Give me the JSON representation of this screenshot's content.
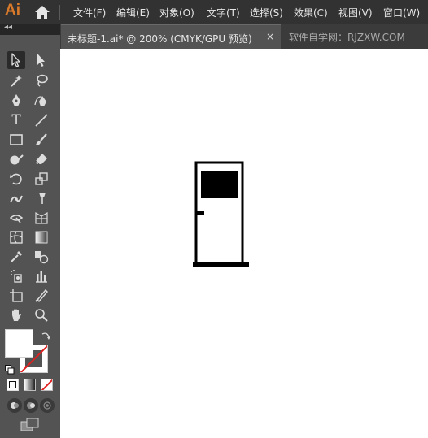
{
  "app": {
    "logo": "Ai"
  },
  "menu": {
    "items": [
      "文件(F)",
      "编辑(E)",
      "对象(O)",
      "文字(T)",
      "选择(S)",
      "效果(C)",
      "视图(V)",
      "窗口(W)"
    ]
  },
  "tabs": {
    "active_label": "未标题-1.ai* @ 200% (CMYK/GPU 预览)",
    "close": "×",
    "other_label": "软件自学网：RJZXW.COM"
  },
  "panel": {
    "collapse": "◂◂"
  },
  "tools": {
    "type_glyph": "T"
  },
  "colors": {
    "accent": "#d97a2b",
    "menubar": "#323232",
    "panel": "#535353",
    "canvas": "#ffffff",
    "none_slash": "#e02020"
  }
}
